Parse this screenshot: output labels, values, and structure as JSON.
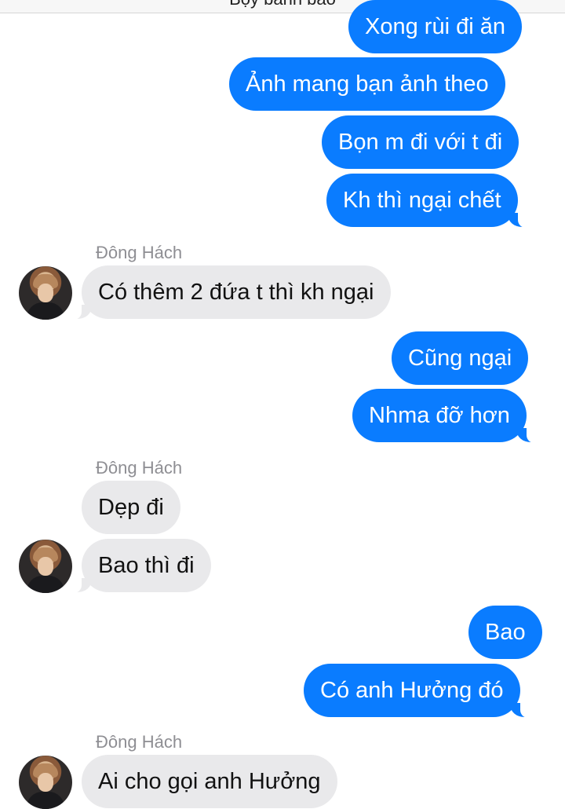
{
  "header": {
    "title": "Bộy bánh bao"
  },
  "conversation": {
    "contact_name": "Đông Hách",
    "messages": [
      {
        "dir": "out",
        "text": "Xong rùi đi ăn"
      },
      {
        "dir": "out",
        "text": "Ảnh mang bạn ảnh theo"
      },
      {
        "dir": "out",
        "text": "Bọn m đi với t đi"
      },
      {
        "dir": "out",
        "text": "Kh thì ngại chết"
      },
      {
        "dir": "in",
        "text": "Có thêm 2 đứa t thì kh ngại"
      },
      {
        "dir": "out",
        "text": "Cũng ngại"
      },
      {
        "dir": "out",
        "text": "Nhma đỡ hơn"
      },
      {
        "dir": "in",
        "text": "Dẹp đi"
      },
      {
        "dir": "in",
        "text": "Bao thì đi"
      },
      {
        "dir": "out",
        "text": "Bao"
      },
      {
        "dir": "out",
        "text": "Có anh Hưởng đó"
      },
      {
        "dir": "in",
        "text": "Ai cho gọi anh Hưởng"
      }
    ]
  },
  "colors": {
    "outgoing": "#0a7cff",
    "incoming": "#e9e9eb",
    "sender_label": "#8e8e93"
  },
  "icons": {
    "avatar": "contact-avatar-photo"
  }
}
